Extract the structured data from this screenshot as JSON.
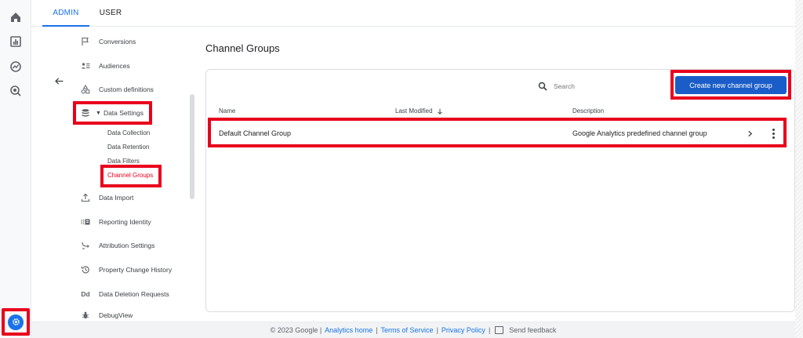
{
  "tabs": {
    "admin": "ADMIN",
    "user": "USER"
  },
  "rail": {
    "icons": [
      "home-icon",
      "reports-icon",
      "explore-icon",
      "advertising-icon",
      "admin-gear-icon"
    ]
  },
  "nav": {
    "items_top": [
      {
        "label": "Conversions",
        "icon": "flag-icon"
      },
      {
        "label": "Audiences",
        "icon": "audiences-icon"
      },
      {
        "label": "Custom definitions",
        "icon": "shapes-icon"
      }
    ],
    "data_settings": {
      "label": "Data Settings",
      "icon": "database-icon"
    },
    "sub_items": [
      "Data Collection",
      "Data Retention",
      "Data Filters",
      "Channel Groups"
    ],
    "items_bottom": [
      {
        "label": "Data Import",
        "icon": "upload-icon"
      },
      {
        "label": "Reporting Identity",
        "icon": "identity-icon"
      },
      {
        "label": "Attribution Settings",
        "icon": "attribution-icon"
      },
      {
        "label": "Property Change History",
        "icon": "history-icon"
      },
      {
        "label": "Data Deletion Requests",
        "icon": "dd-icon",
        "icon_text": "Dd"
      },
      {
        "label": "DebugView",
        "icon": "debug-icon"
      }
    ]
  },
  "main": {
    "title": "Channel Groups",
    "search_placeholder": "Search",
    "create_button": "Create new channel group",
    "columns": {
      "name": "Name",
      "last_modified": "Last Modified",
      "description": "Description"
    },
    "rows": [
      {
        "name": "Default Channel Group",
        "last_modified": "",
        "description": "Google Analytics predefined channel group"
      }
    ]
  },
  "footer": {
    "copyright": "© 2023 Google |",
    "analytics_home": "Analytics home",
    "terms": "Terms of Service",
    "privacy": "Privacy Policy",
    "sep": "|",
    "feedback": "Send feedback"
  },
  "colors": {
    "accent": "#1a73e8",
    "highlight": "#e8001c",
    "button": "#1a5dc8"
  }
}
